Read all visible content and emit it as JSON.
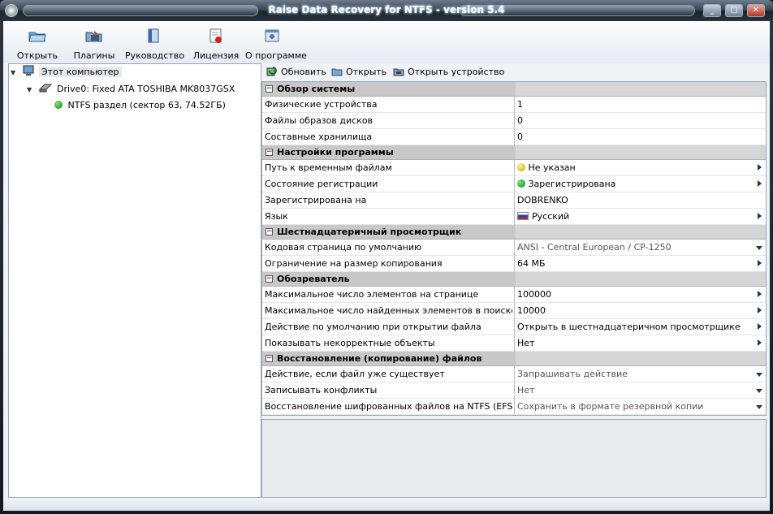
{
  "window": {
    "title": "Raise Data Recovery for NTFS - version 5.4",
    "controls": [
      "_",
      "▢",
      "✕"
    ]
  },
  "toolbar": {
    "buttons": [
      {
        "label": "Открыть",
        "icon": "folder-open-icon"
      },
      {
        "label": "Плагины",
        "icon": "plugins-icon"
      },
      {
        "label": "Руководство",
        "icon": "manual-icon"
      },
      {
        "label": "Лицензия",
        "icon": "license-icon"
      },
      {
        "label": "О программе",
        "icon": "about-icon"
      }
    ]
  },
  "tree": {
    "items": [
      {
        "label": "Этот компьютер",
        "icon": "computer-icon"
      },
      {
        "label": "Drive0: Fixed ATA TOSHIBA MK8037GSX",
        "icon": "hard-drive-icon"
      },
      {
        "label": "NTFS раздел (сектор 63, 74.52ГБ)",
        "icon": "green-status-icon"
      }
    ]
  },
  "right_toolbar": {
    "refresh": "Обновить",
    "open": "Открыть",
    "open_device": "Открыть устройство"
  },
  "properties": {
    "categories": [
      {
        "title": "Обзор системы",
        "rows": [
          {
            "name": "Физические устройства",
            "value": "1"
          },
          {
            "name": "Файлы образов дисков",
            "value": "0"
          },
          {
            "name": "Составные хранилища",
            "value": "0"
          }
        ]
      },
      {
        "title": "Настройки программы",
        "rows": [
          {
            "name": "Путь к временным файлам",
            "value": "Не указан"
          },
          {
            "name": "Состояние регистрации",
            "value": "Зарегистрирована"
          },
          {
            "name": "Зарегистрирована на",
            "value": "DOBRENKO"
          },
          {
            "name": "Язык",
            "value": "Русский"
          }
        ]
      },
      {
        "title": "Шестнадцатеричный просмотрщик",
        "rows": [
          {
            "name": "Кодовая страница по умолчанию",
            "value": "ANSI - Central European / CP-1250"
          },
          {
            "name": "Ограничение на размер копирования",
            "value": "64 МБ"
          }
        ]
      },
      {
        "title": "Обозреватель",
        "rows": [
          {
            "name": "Максимальное число элементов на странице",
            "value": "100000"
          },
          {
            "name": "Максимальное число найденных элементов в поиске",
            "value": "10000"
          },
          {
            "name": "Действие по умолчанию при открытии файла",
            "value": "Открыть в шестнадцатеричном просмотрщике"
          },
          {
            "name": "Показывать некорректные объекты",
            "value": "Нет"
          }
        ]
      },
      {
        "title": "Восстановление (копирование) файлов",
        "rows": [
          {
            "name": "Действие, если файл уже существует",
            "value": "Запрашивать действие"
          },
          {
            "name": "Записывать конфликты",
            "value": "Нет"
          },
          {
            "name": "Восстановление шифрованных файлов на NTFS (EFS)",
            "value": "Сохранить в формате резервной копии"
          }
        ]
      }
    ]
  }
}
